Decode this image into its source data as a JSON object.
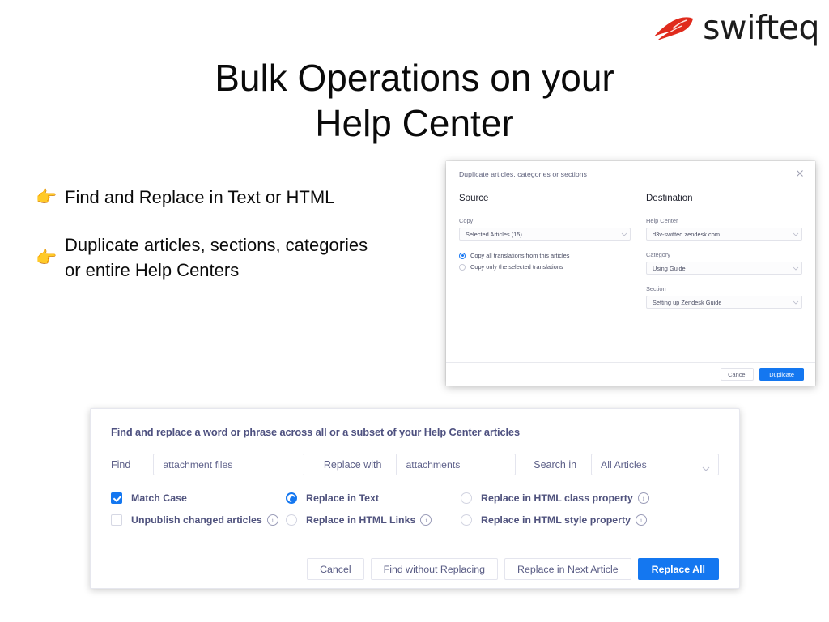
{
  "brand": {
    "name": "swifteq",
    "logo_icon": "swifteq-flame-logo",
    "logo_color": "#e02b1d"
  },
  "headline": {
    "line1": "Bulk Operations on your",
    "line2": "Help Center"
  },
  "bullets": [
    {
      "icon": "pointing-right-hand-emoji",
      "glyph": "👉",
      "text": "Find and Replace in Text or HTML"
    },
    {
      "icon": "pointing-right-hand-emoji",
      "glyph": "👉",
      "text": "Duplicate articles, sections, categories or entire Help Centers"
    }
  ],
  "duplicate_dialog": {
    "title": "Duplicate articles, categories or sections",
    "close_icon": "close-icon",
    "source": {
      "heading": "Source",
      "copy_label": "Copy",
      "copy_value": "Selected Articles (15)",
      "translation_options": [
        {
          "label": "Copy all translations from this articles",
          "selected": true
        },
        {
          "label": "Copy only the selected translations",
          "selected": false
        }
      ]
    },
    "destination": {
      "heading": "Destination",
      "help_center_label": "Help Center",
      "help_center_value": "d3v-swifteq.zendesk.com",
      "category_label": "Category",
      "category_value": "Using Guide",
      "section_label": "Section",
      "section_value": "Setting up Zendesk Guide"
    },
    "footer": {
      "cancel_label": "Cancel",
      "duplicate_label": "Duplicate"
    }
  },
  "find_replace": {
    "heading": "Find and replace a word or phrase across all or a subset of your Help Center articles",
    "find_label": "Find",
    "find_value": "attachment files",
    "replace_label": "Replace with",
    "replace_value": "attachments",
    "search_in_label": "Search in",
    "search_in_value": "All Articles",
    "options": {
      "match_case": {
        "label": "Match Case",
        "checked": true
      },
      "unpublish": {
        "label": "Unpublish changed articles",
        "checked": false,
        "info": true
      },
      "replace_in_text": {
        "label": "Replace in Text",
        "selected": true
      },
      "replace_in_html_links": {
        "label": "Replace in HTML Links",
        "selected": false,
        "info": true
      },
      "replace_in_html_class": {
        "label": "Replace in HTML class property",
        "selected": false,
        "info": true
      },
      "replace_in_html_style": {
        "label": "Replace in HTML style property",
        "selected": false,
        "info": true
      }
    },
    "buttons": {
      "cancel": "Cancel",
      "find_without_replacing": "Find without Replacing",
      "replace_next": "Replace in Next Article",
      "replace_all": "Replace All"
    }
  },
  "theme": {
    "accent_blue": "#1477f0",
    "brand_red": "#e02b1d",
    "text_indigo": "#50537e"
  }
}
